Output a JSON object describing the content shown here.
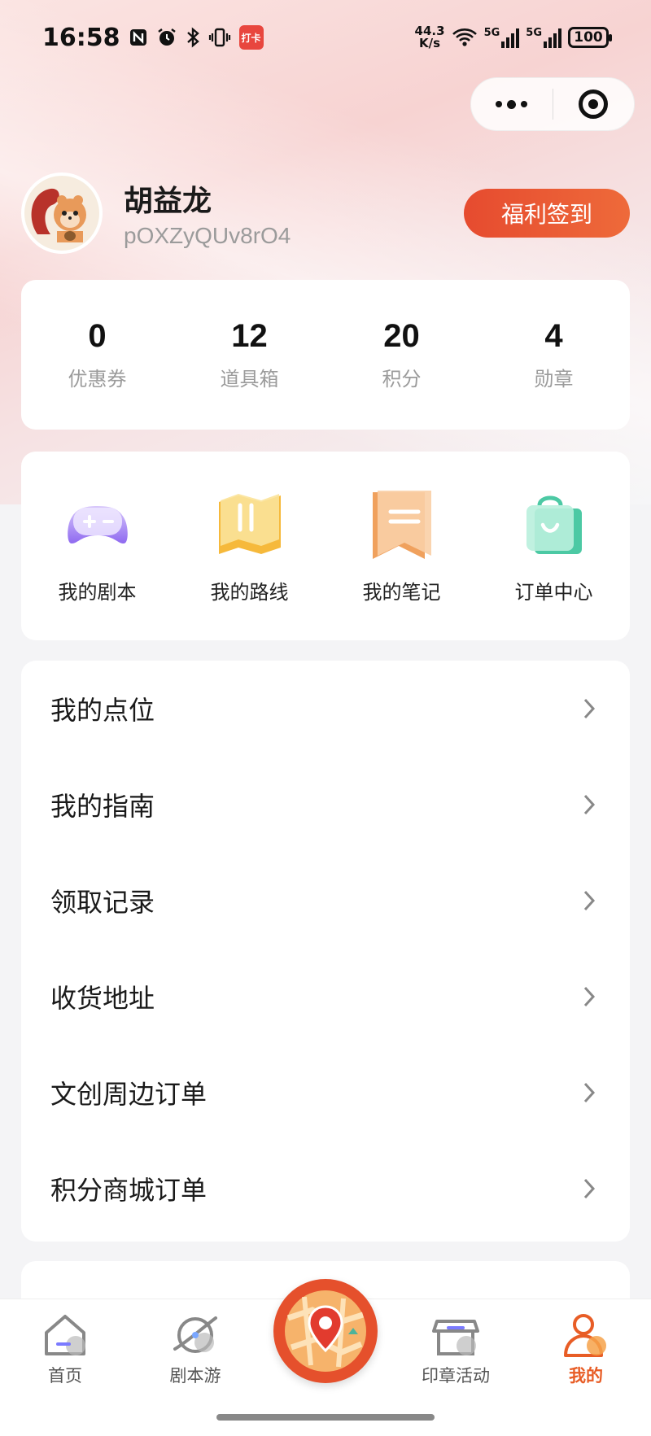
{
  "status_bar": {
    "time": "16:58",
    "net_speed_value": "44.3",
    "net_speed_unit": "K/s",
    "sim1_label": "5G",
    "sim2_label": "5G",
    "battery": "100",
    "app_icon_text": "打卡"
  },
  "capsule": {
    "more_icon": "more-dots-icon",
    "close_icon": "target-icon"
  },
  "profile": {
    "name": "胡益龙",
    "user_id": "pOXZyQUv8rO4",
    "signin_label": "福利签到"
  },
  "stats": [
    {
      "value": "0",
      "label": "优惠券"
    },
    {
      "value": "12",
      "label": "道具箱"
    },
    {
      "value": "20",
      "label": "积分"
    },
    {
      "value": "4",
      "label": "勋章"
    }
  ],
  "shortcuts": [
    {
      "label": "我的剧本",
      "icon": "gamepad-icon"
    },
    {
      "label": "我的路线",
      "icon": "map-icon"
    },
    {
      "label": "我的笔记",
      "icon": "note-icon"
    },
    {
      "label": "订单中心",
      "icon": "shopping-bag-icon"
    }
  ],
  "menu": [
    {
      "label": "我的点位"
    },
    {
      "label": "我的指南"
    },
    {
      "label": "领取记录"
    },
    {
      "label": "收货地址"
    },
    {
      "label": "文创周边订单"
    },
    {
      "label": "积分商城订单"
    }
  ],
  "tabs": [
    {
      "label": "首页",
      "icon": "home-icon"
    },
    {
      "label": "剧本游",
      "icon": "planet-icon"
    },
    {
      "label": "",
      "icon": "map-pin-icon"
    },
    {
      "label": "印章活动",
      "icon": "shop-icon"
    },
    {
      "label": "我的",
      "icon": "user-icon"
    }
  ],
  "colors": {
    "accent": "#e85d26",
    "signin_gradient_start": "#e64b2f",
    "signin_gradient_end": "#ee6a3a"
  }
}
